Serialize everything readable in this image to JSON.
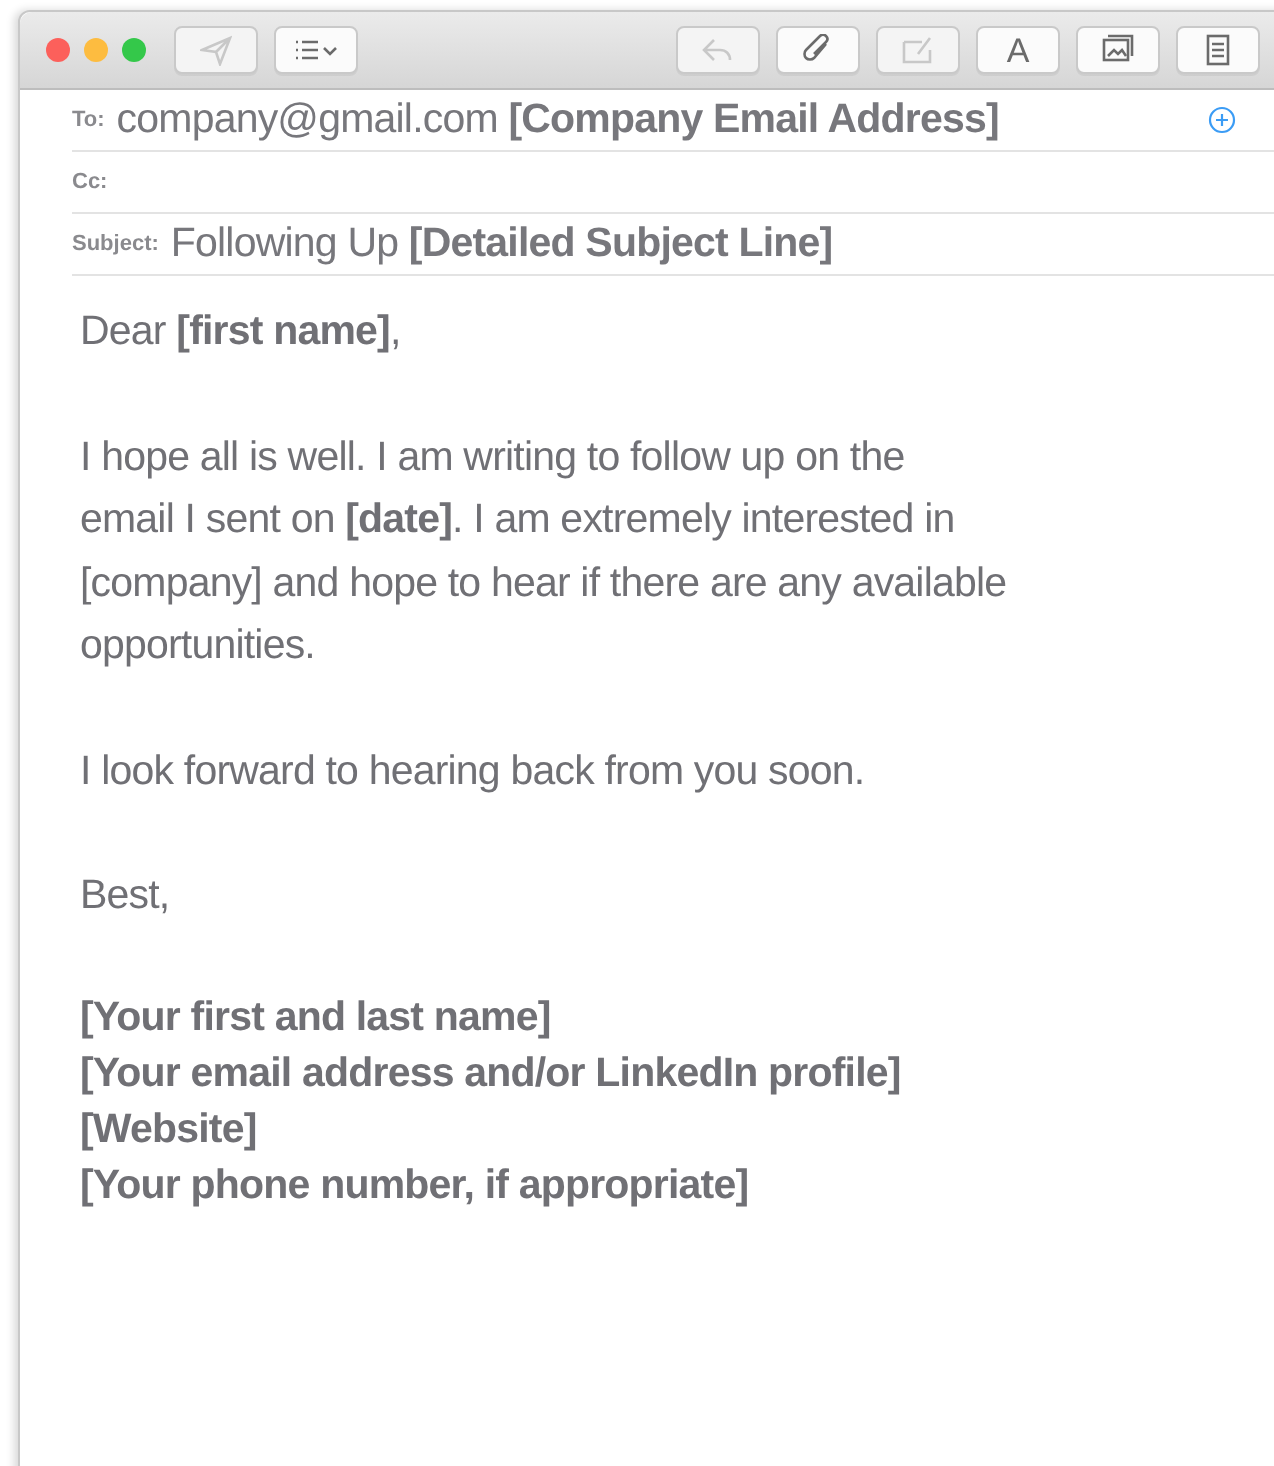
{
  "window": {
    "traffic_lights": [
      {
        "color": "#fc605b"
      },
      {
        "color": "#fdbc40"
      },
      {
        "color": "#34c84a"
      }
    ]
  },
  "toolbar": {
    "left": [
      {
        "kind": "send",
        "disabled": true
      },
      {
        "kind": "list",
        "disabled": false
      }
    ],
    "right": [
      {
        "kind": "reply",
        "disabled": true
      },
      {
        "kind": "attach",
        "disabled": false
      },
      {
        "kind": "markup",
        "disabled": true
      },
      {
        "kind": "font",
        "disabled": false,
        "label": "A"
      },
      {
        "kind": "photo",
        "disabled": false
      },
      {
        "kind": "format",
        "disabled": false
      }
    ]
  },
  "fields": [
    {
      "label": "To:",
      "value": "company@gmail.com **[Company Email Address]**",
      "add_button": true
    },
    {
      "label": "Cc:",
      "add_button": false
    },
    {
      "label": "Subject:",
      "value": "Following Up **[Detailed Subject Line]**",
      "add_button": false
    }
  ],
  "body": {
    "paragraphs": [
      [
        "Dear **[first name]**,"
      ],
      [
        "I hope all is well. I am writing to follow up on the",
        "email I sent on **[date]**. I am extremely interested in",
        "[company] and hope to hear if there are any available",
        "opportunities."
      ],
      [
        "I look forward to hearing back from you soon."
      ],
      [
        "Best,"
      ]
    ],
    "signature": [
      "[Your first and last name]",
      "[Your email address and/or LinkedIn profile]",
      "[Website]",
      "[Your phone number, if appropriate]"
    ]
  }
}
